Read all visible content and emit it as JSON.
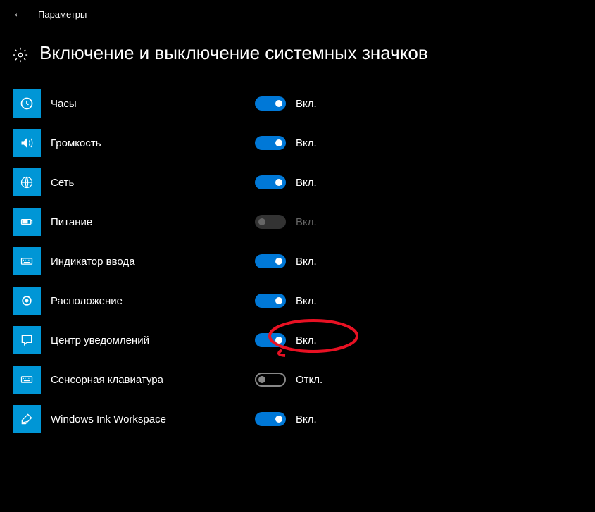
{
  "header": {
    "title": "Параметры"
  },
  "page": {
    "title": "Включение и выключение системных значков"
  },
  "labels": {
    "on": "Вкл.",
    "off": "Откл."
  },
  "settings": [
    {
      "id": "clock",
      "label": "Часы",
      "state": "on",
      "icon": "clock"
    },
    {
      "id": "volume",
      "label": "Громкость",
      "state": "on",
      "icon": "volume"
    },
    {
      "id": "network",
      "label": "Сеть",
      "state": "on",
      "icon": "network"
    },
    {
      "id": "power",
      "label": "Питание",
      "state": "disabled",
      "icon": "power"
    },
    {
      "id": "input-indicator",
      "label": "Индикатор ввода",
      "state": "on",
      "icon": "keyboard"
    },
    {
      "id": "location",
      "label": "Расположение",
      "state": "on",
      "icon": "location"
    },
    {
      "id": "action-center",
      "label": "Центр уведомлений",
      "state": "on",
      "icon": "notification"
    },
    {
      "id": "touch-keyboard",
      "label": "Сенсорная клавиатура",
      "state": "off",
      "icon": "keyboard"
    },
    {
      "id": "windows-ink",
      "label": "Windows Ink Workspace",
      "state": "on",
      "icon": "pen"
    }
  ],
  "annotation": {
    "highlighted_item": "action-center",
    "color": "#e81123"
  }
}
